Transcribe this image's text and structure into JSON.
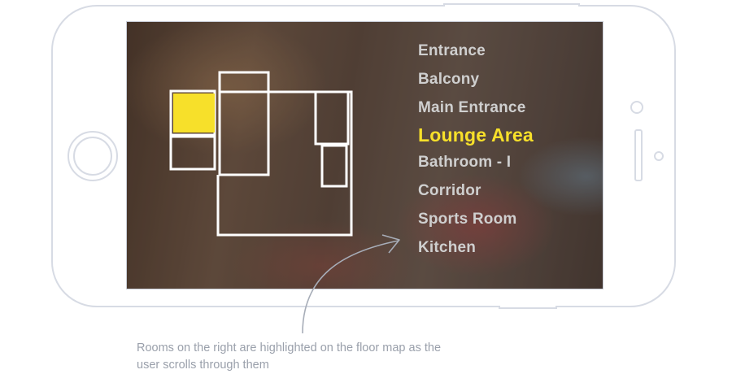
{
  "rooms": [
    {
      "label": "Entrance",
      "active": false
    },
    {
      "label": "Balcony",
      "active": false
    },
    {
      "label": "Main Entrance",
      "active": false
    },
    {
      "label": "Lounge Area",
      "active": true
    },
    {
      "label": "Bathroom - I",
      "active": false
    },
    {
      "label": "Corridor",
      "active": false
    },
    {
      "label": "Sports Room",
      "active": false
    },
    {
      "label": "Kitchen",
      "active": false
    }
  ],
  "caption": "Rooms on the right are highlighted on the floor map as the user scrolls through them",
  "colors": {
    "highlight": "#f7e02a",
    "room_text": "#cfcfcf",
    "frame": "#d7dbe4",
    "caption": "#9aa0ab"
  }
}
